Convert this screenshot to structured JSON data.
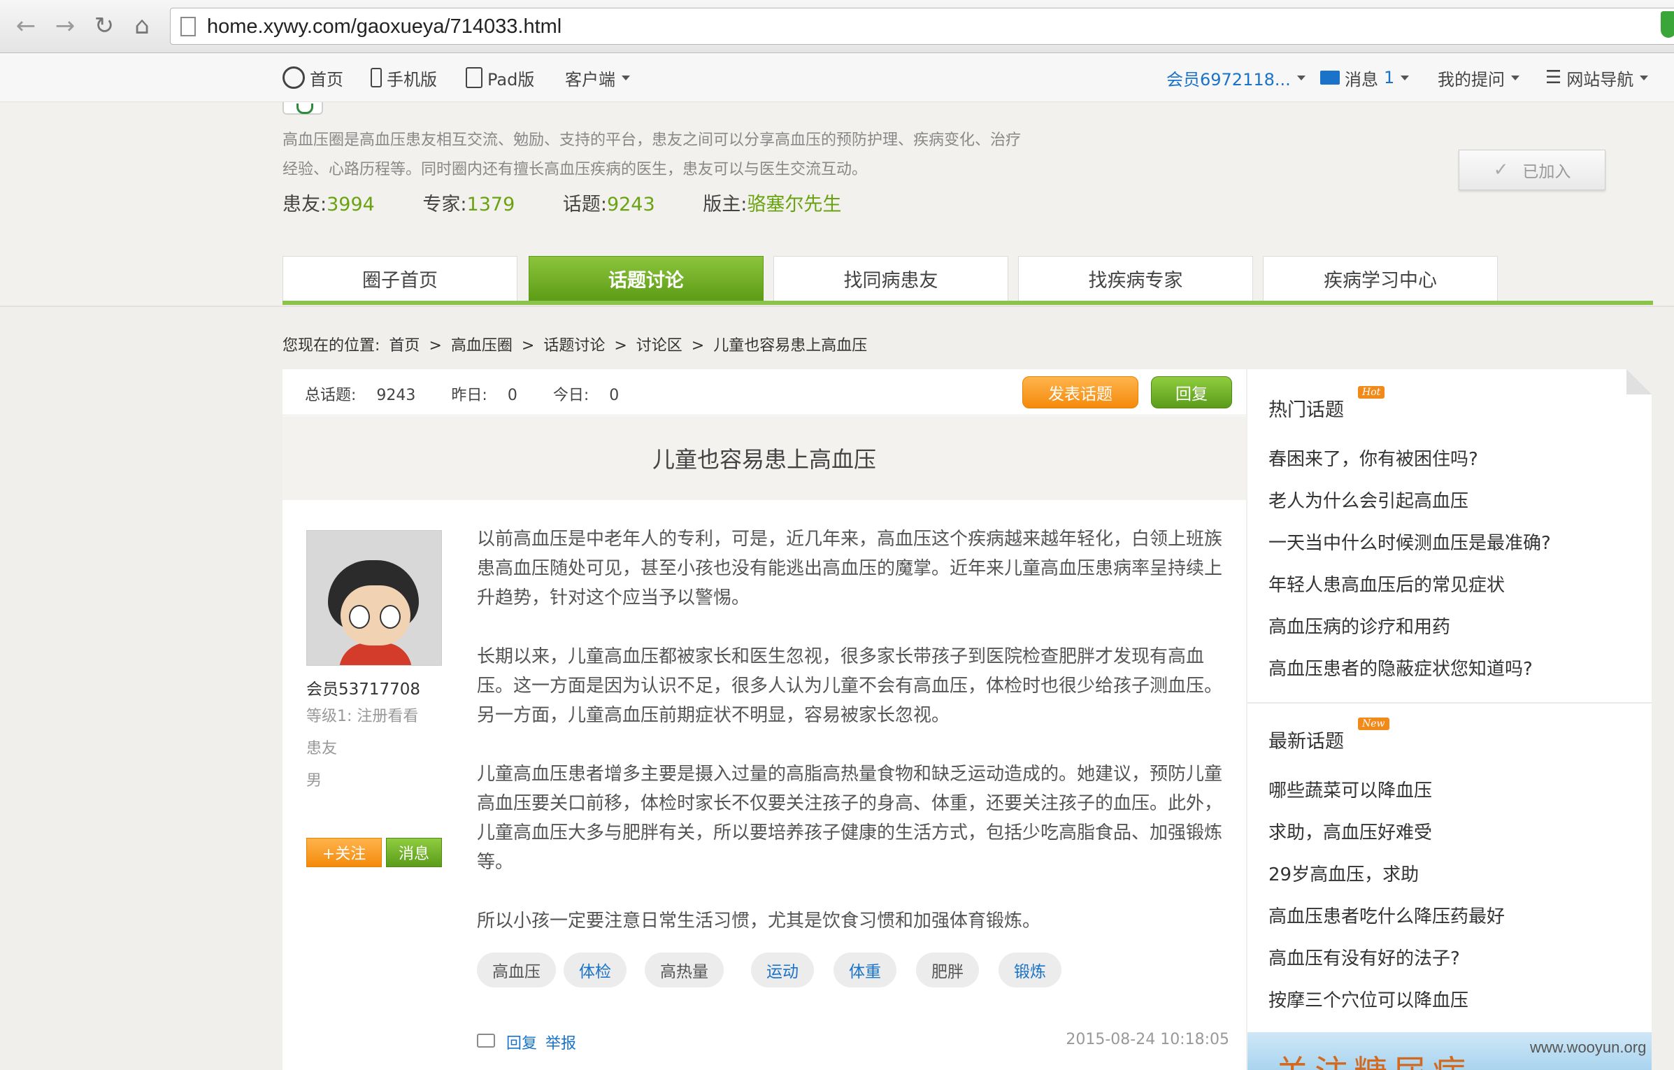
{
  "browser": {
    "url": "home.xywy.com/gaoxueya/714033.html",
    "back_icon": "arrow-left-icon",
    "forward_icon": "arrow-right-icon",
    "reload_icon": "reload-icon",
    "home_icon": "home-icon"
  },
  "topbar": {
    "home": "首页",
    "mobile": "手机版",
    "pad": "Pad版",
    "client": "客户端",
    "member": "会员6972118...",
    "messages": "消息",
    "messages_count": "1",
    "my_questions": "我的提问",
    "site_nav": "网站导航"
  },
  "circle": {
    "description": "高血压圈是高血压患友相互交流、勉励、支持的平台，患友之间可以分享高血压的预防护理、疾病变化、治疗经验、心路历程等。同时圈内还有擅长高血压疾病的医生，患友可以与医生交流互动。",
    "patients_label": "患友:",
    "patients": "3994",
    "experts_label": "专家:",
    "experts": "1379",
    "topics_label": "话题:",
    "topics": "9243",
    "moderator_label": "版主:",
    "moderator": "骆塞尔先生",
    "joined_label": "已加入"
  },
  "tabs": [
    {
      "label": "圈子首页"
    },
    {
      "label": "话题讨论"
    },
    {
      "label": "找同病患友"
    },
    {
      "label": "找疾病专家"
    },
    {
      "label": "疾病学习中心"
    }
  ],
  "breadcrumb": {
    "prefix": "您现在的位置:",
    "items": [
      "首页",
      "高血压圈",
      "话题讨论",
      "讨论区",
      "儿童也容易患上高血压"
    ],
    "sep": ">"
  },
  "main": {
    "total_label": "总话题:",
    "total": "9243",
    "yesterday_label": "昨日:",
    "yesterday": "0",
    "today_label": "今日:",
    "today": "0",
    "post_button": "发表话题",
    "reply_button": "回复",
    "title": "儿童也容易患上高血压"
  },
  "author": {
    "name": "会员53717708",
    "level": "等级1: 注册看看",
    "role": "患友",
    "gender": "男",
    "follow": "+关注",
    "message": "消息"
  },
  "post": {
    "paragraphs": [
      "以前高血压是中老年人的专利，可是，近几年来，高血压这个疾病越来越年轻化，白领上班族患高血压随处可见，甚至小孩也没有能逃出高血压的魔掌。近年来儿童高血压患病率呈持续上升趋势，针对这个应当予以警惕。",
      "长期以来，儿童高血压都被家长和医生忽视，很多家长带孩子到医院检查肥胖才发现有高血压。这一方面是因为认识不足，很多人认为儿童不会有高血压，体检时也很少给孩子测血压。另一方面，儿童高血压前期症状不明显，容易被家长忽视。",
      "儿童高血压患者增多主要是摄入过量的高脂高热量食物和缺乏运动造成的。她建议，预防儿童高血压要关口前移，体检时家长不仅要关注孩子的身高、体重，还要关注孩子的血压。此外，儿童高血压大多与肥胖有关，所以要培养孩子健康的生活方式，包括少吃高脂食品、加强锻炼等。",
      "所以小孩一定要注意日常生活习惯，尤其是饮食习惯和加强体育锻炼。"
    ],
    "tags": [
      "高血压",
      "体检",
      "高热量",
      "运动",
      "体重",
      "肥胖",
      "锻炼"
    ],
    "reply": "回复",
    "report": "举报",
    "timestamp": "2015-08-24 10:18:05"
  },
  "sidebar": {
    "hot_title": "热门话题",
    "hot_badge": "Hot",
    "hot": [
      "春困来了，你有被困住吗?",
      "老人为什么会引起高血压",
      "一天当中什么时候测血压是最准确?",
      "年轻人患高血压后的常见症状",
      "高血压病的诊疗和用药",
      "高血压患者的隐蔽症状您知道吗?"
    ],
    "new_title": "最新话题",
    "new_badge": "New",
    "latest": [
      "哪些蔬菜可以降血压",
      "求助，高血压好难受",
      "29岁高血压，求助",
      "高血压患者吃什么降压药最好",
      "高血压有没有好的法子?",
      "按摩三个穴位可以降血压"
    ],
    "banner_text": "关注糖尿病"
  },
  "watermark": "www.wooyun.org",
  "colors": {
    "accent_green": "#6aa312",
    "orange": "#f48a0c",
    "link_blue": "#1a73c8"
  }
}
